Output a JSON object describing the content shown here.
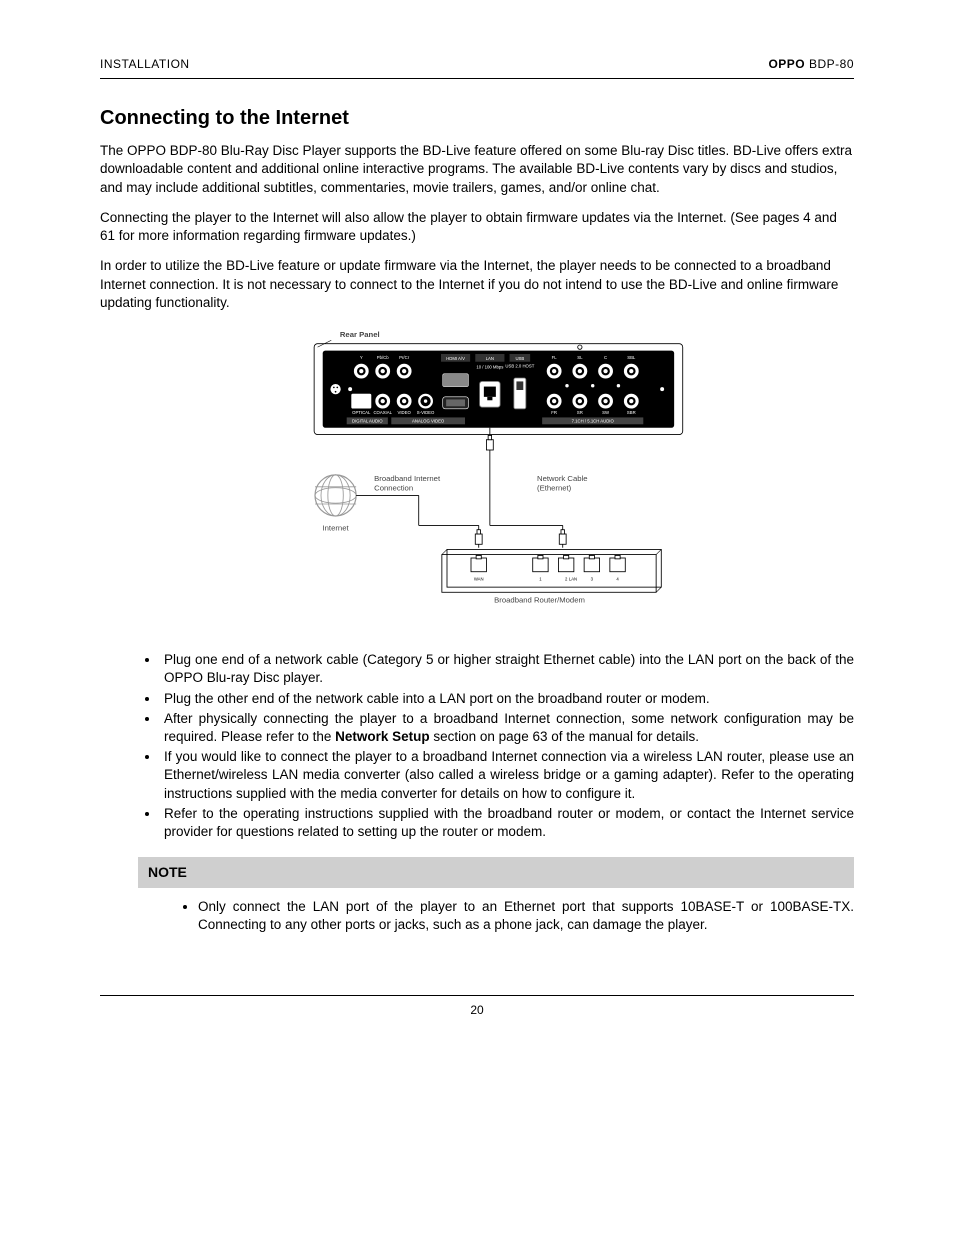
{
  "header": {
    "left": "INSTALLATION",
    "right_make": "OPPO",
    "right_model": "BDP-80"
  },
  "title": "Connecting to the Internet",
  "para1": "The OPPO BDP-80 Blu-Ray Disc Player supports the BD-Live feature offered on some Blu-ray Disc titles. BD-Live offers extra downloadable content and additional online interactive programs.  The available BD-Live contents vary by discs and studios, and may include additional subtitles, commentaries, movie trailers, games, and/or online chat.",
  "para2": "Connecting the player to the Internet will also allow the player to obtain firmware updates via the Internet. (See pages 4 and 61 for more information regarding firmware updates.)",
  "para3": "In order to utilize the BD-Live feature or update firmware via the Internet, the player needs to be connected to a broadband Internet connection.  It is not necessary to connect to the Internet if you do not intend to use the BD-Live and online firmware updating functionality.",
  "diagram": {
    "rear_panel": "Rear Panel",
    "bic": "Broadband Internet Connection",
    "net_cable": "Network Cable (Ethernet)",
    "internet": "Internet",
    "router": "Broadband Router/Modem",
    "wan": "WAN",
    "lan": "LAN",
    "ports": [
      "1",
      "2",
      "3",
      "4"
    ],
    "panel_text": {
      "hdmi": "HDMI A/V",
      "lan": "LAN",
      "usb": "USB",
      "lanrate": "10 / 100 Mbps",
      "usbrate": "USB 2.0  HOST",
      "y": "Y",
      "pbcb": "Pb/Cb",
      "prcr": "Pr/Cr",
      "optical": "OPTICAL",
      "coaxial": "COAXIAL",
      "video": "VIDEO",
      "svideo": "S-VIDEO",
      "da": "DIGITAL AUDIO",
      "av": "ANALOG VIDEO",
      "fl": "FL",
      "sl": "SL",
      "c": "C",
      "sbl": "SBL",
      "fr": "FR",
      "sr": "SR",
      "sw": "SW",
      "sbr": "SBR",
      "ch": "7.1CH / 5.1CH AUDIO"
    }
  },
  "bullets": {
    "b1": "Plug one end of a network cable (Category 5 or higher straight Ethernet cable) into the LAN port on the back of the OPPO Blu-ray Disc player.",
    "b2": "Plug the other end of the network cable into a LAN port on the broadband router or modem.",
    "b3a": "After physically connecting the player to a broadband Internet connection, some network configuration may be required.  Please refer to the ",
    "b3ref": "Network Setup",
    "b3b": " section on page 63 of the manual for details.",
    "b4": "If you would like to connect the player to a broadband Internet connection via a wireless LAN router, please use an Ethernet/wireless LAN media converter (also called a wireless bridge or a gaming adapter).  Refer to the operating instructions supplied with the media converter for details on how to configure it.",
    "b5": "Refer to the operating instructions supplied with the broadband router or modem, or contact the Internet service provider for questions related to setting up the router or modem."
  },
  "note": {
    "title": "NOTE",
    "body": "Only connect the LAN port of the player to an Ethernet port that supports 10BASE-T or 100BASE-TX.  Connecting to any other ports or jacks, such as a phone jack, can damage the player."
  },
  "footer": {
    "pagenum": "20"
  }
}
